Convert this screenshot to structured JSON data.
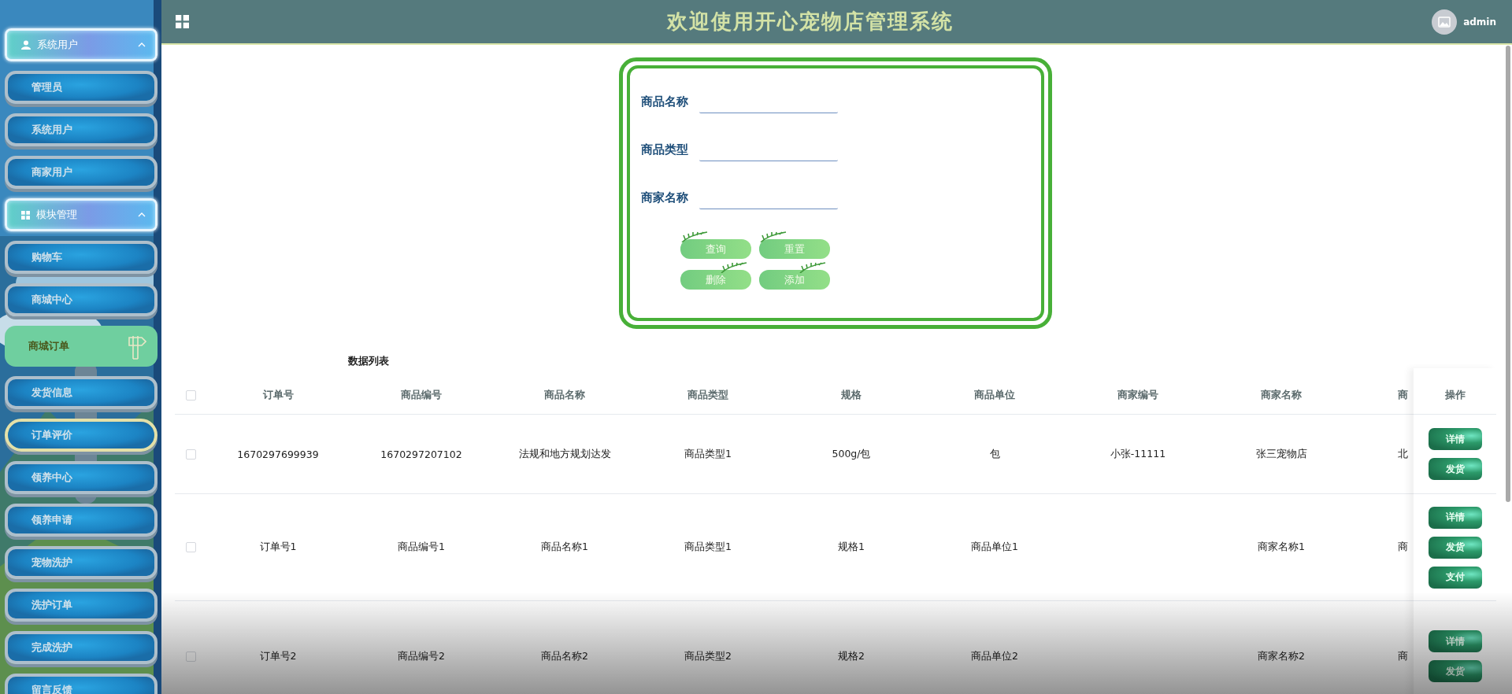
{
  "header": {
    "title": "欢迎使用开心宠物店管理系统",
    "user": "admin"
  },
  "sidebar": {
    "groups": [
      {
        "label": "系统用户",
        "expanded": true,
        "items": [
          {
            "label": "管理员",
            "selected": false,
            "hovered": false
          },
          {
            "label": "系统用户",
            "selected": false,
            "hovered": false
          },
          {
            "label": "商家用户",
            "selected": false,
            "hovered": false
          }
        ]
      },
      {
        "label": "模块管理",
        "expanded": true,
        "items": [
          {
            "label": "购物车",
            "selected": false,
            "hovered": false
          },
          {
            "label": "商城中心",
            "selected": false,
            "hovered": false
          },
          {
            "label": "商城订单",
            "selected": true,
            "hovered": false
          },
          {
            "label": "发货信息",
            "selected": false,
            "hovered": false
          },
          {
            "label": "订单评价",
            "selected": false,
            "hovered": true
          },
          {
            "label": "领养中心",
            "selected": false,
            "hovered": false
          },
          {
            "label": "领养申请",
            "selected": false,
            "hovered": false
          },
          {
            "label": "宠物洗护",
            "selected": false,
            "hovered": false
          },
          {
            "label": "洗护订单",
            "selected": false,
            "hovered": false
          },
          {
            "label": "完成洗护",
            "selected": false,
            "hovered": false
          },
          {
            "label": "留言反馈",
            "selected": false,
            "hovered": false
          }
        ]
      }
    ]
  },
  "search": {
    "fields": [
      {
        "label": "商品名称"
      },
      {
        "label": "商品类型"
      },
      {
        "label": "商家名称"
      }
    ],
    "buttons": [
      "查询",
      "重置",
      "删除",
      "添加"
    ]
  },
  "table": {
    "title": "数据列表",
    "header_checked": false,
    "columns": [
      "订单号",
      "商品编号",
      "商品名称",
      "商品类型",
      "规格",
      "商品单位",
      "商家编号",
      "商家名称",
      "商"
    ],
    "action_column": "操作",
    "rows": [
      {
        "checked": false,
        "cells": [
          "1670297699939",
          "1670297207102",
          "法规和地方规划达发",
          "商品类型1",
          "500g/包",
          "包",
          "小张-11111",
          "张三宠物店",
          "北"
        ],
        "actions": [
          "详情",
          "发货"
        ]
      },
      {
        "checked": false,
        "cells": [
          "订单号1",
          "商品编号1",
          "商品名称1",
          "商品类型1",
          "规格1",
          "商品单位1",
          null,
          "商家名称1",
          "商"
        ],
        "actions": [
          "详情",
          "发货",
          "支付"
        ]
      },
      {
        "checked": false,
        "cells": [
          "订单号2",
          "商品编号2",
          "商品名称2",
          "商品类型2",
          "规格2",
          "商品单位2",
          null,
          "商家名称2",
          "商"
        ],
        "actions": [
          "详情",
          "发货"
        ]
      }
    ]
  }
}
